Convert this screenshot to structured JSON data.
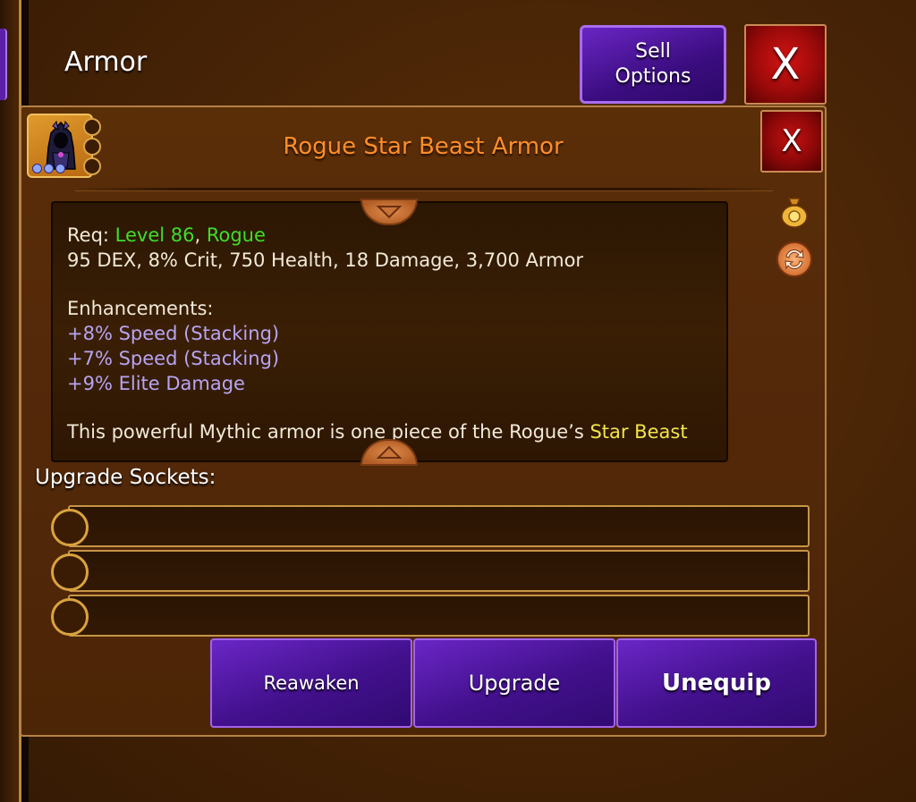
{
  "header": {
    "title": "Armor",
    "sell_button_label": "Sell\nOptions",
    "close_label": "X"
  },
  "item": {
    "name": "Rogue Star Beast Armor",
    "close_label": "X",
    "req_prefix": "Req: ",
    "req_level": "Level 86",
    "req_sep": ", ",
    "req_class": "Rogue",
    "stats": "95 DEX, 8% Crit, 750 Health, 18 Damage, 3,700 Armor",
    "enhancements_label": "Enhancements:",
    "enhancements": [
      "+8% Speed (Stacking)",
      "+7% Speed (Stacking)",
      "+9% Elite Damage"
    ],
    "description_prefix": "This powerful Mythic armor is one piece of the Rogue’s ",
    "description_highlight": "Star Beast"
  },
  "sockets": {
    "label": "Upgrade Sockets:",
    "slots": [
      "",
      "",
      ""
    ]
  },
  "actions": {
    "reawaken": "Reawaken",
    "upgrade": "Upgrade",
    "unequip": "Unequip"
  },
  "colors": {
    "panel_bg": "#54290a",
    "title_orange": "#ff8d2a",
    "req_green": "#3fdd2d",
    "enhancement_purple": "#b8a4f2",
    "set_yellow": "#f2e54a",
    "button_purple": "#42108c",
    "close_red": "#9c0a0a"
  },
  "icons": {
    "item": "hooded-armor-icon",
    "currency": "gold-bag-icon",
    "swap": "swap-arrows-icon",
    "scroll_up": "triangle-down-icon",
    "scroll_down": "triangle-up-icon"
  }
}
